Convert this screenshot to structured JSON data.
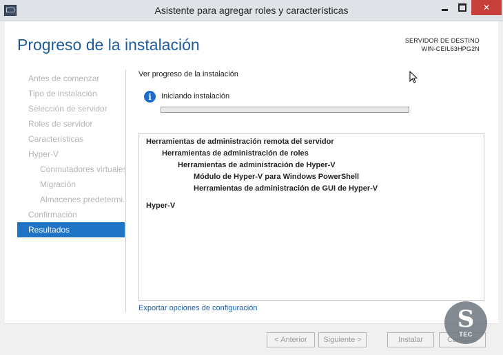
{
  "window": {
    "title": "Asistente para agregar roles y características",
    "minimize_icon": "minimize-icon",
    "maximize_icon": "maximize-icon",
    "close_icon": "close-icon",
    "close_glyph": "✕"
  },
  "header": {
    "heading": "Progreso de la instalación",
    "destination_label": "SERVIDOR DE DESTINO",
    "destination_server": "WIN-CEIL63HPG2N"
  },
  "nav": {
    "items": [
      {
        "label": "Antes de comenzar",
        "level": 0,
        "active": false
      },
      {
        "label": "Tipo de instalación",
        "level": 0,
        "active": false
      },
      {
        "label": "Selección de servidor",
        "level": 0,
        "active": false
      },
      {
        "label": "Roles de servidor",
        "level": 0,
        "active": false
      },
      {
        "label": "Características",
        "level": 0,
        "active": false
      },
      {
        "label": "Hyper-V",
        "level": 0,
        "active": false
      },
      {
        "label": "Conmutadores virtuales",
        "level": 1,
        "active": false
      },
      {
        "label": "Migración",
        "level": 1,
        "active": false
      },
      {
        "label": "Almacenes predetermi...",
        "level": 1,
        "active": false
      },
      {
        "label": "Confirmación",
        "level": 0,
        "active": false
      },
      {
        "label": "Resultados",
        "level": 0,
        "active": true
      }
    ]
  },
  "main": {
    "section_title": "Ver progreso de la instalación",
    "status_icon": "info-icon",
    "status_glyph": "i",
    "status_text": "Iniciando instalación",
    "progress_fraction": 0,
    "features": [
      {
        "label": "Herramientas de administración remota del servidor",
        "level": 0
      },
      {
        "label": "Herramientas de administración de roles",
        "level": 1
      },
      {
        "label": "Herramientas de administración de Hyper-V",
        "level": 2
      },
      {
        "label": "Módulo de Hyper-V para Windows PowerShell",
        "level": 3
      },
      {
        "label": "Herramientas de administración de GUI de Hyper-V",
        "level": 3
      },
      {
        "label": "Hyper-V",
        "level": 0
      }
    ],
    "export_link": "Exportar opciones de configuración"
  },
  "footer": {
    "previous": "< Anterior",
    "next": "Siguiente >",
    "install": "Instalar",
    "cancel": "Cancelar"
  },
  "watermark": {
    "glyph": "S",
    "text": "TEC"
  }
}
